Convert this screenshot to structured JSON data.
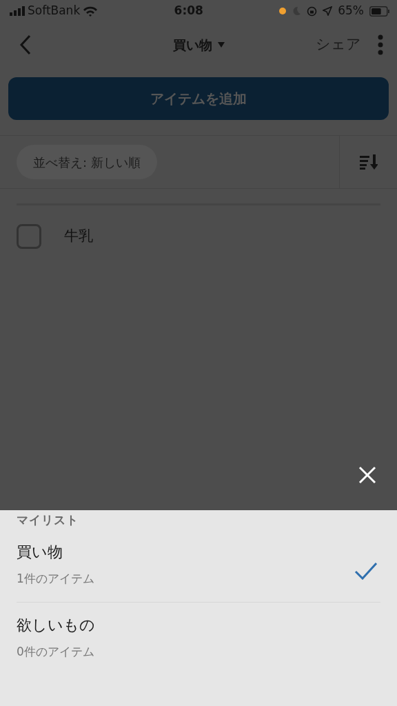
{
  "status_bar": {
    "carrier": "SoftBank",
    "time": "6:08",
    "battery": "65%",
    "battery_meter": {
      "level": 0.65
    }
  },
  "nav": {
    "title": "買い物",
    "share": "シェア"
  },
  "add_button": "アイテムを追加",
  "sort": {
    "label": "並べ替え: 新しい順"
  },
  "items": [
    {
      "label": "牛乳",
      "checked": false
    }
  ],
  "sheet": {
    "heading": "マイリスト",
    "lists": [
      {
        "name": "買い物",
        "count": "1件のアイテム",
        "selected": true
      },
      {
        "name": "欲しいもの",
        "count": "0件のアイテム",
        "selected": false
      }
    ]
  }
}
